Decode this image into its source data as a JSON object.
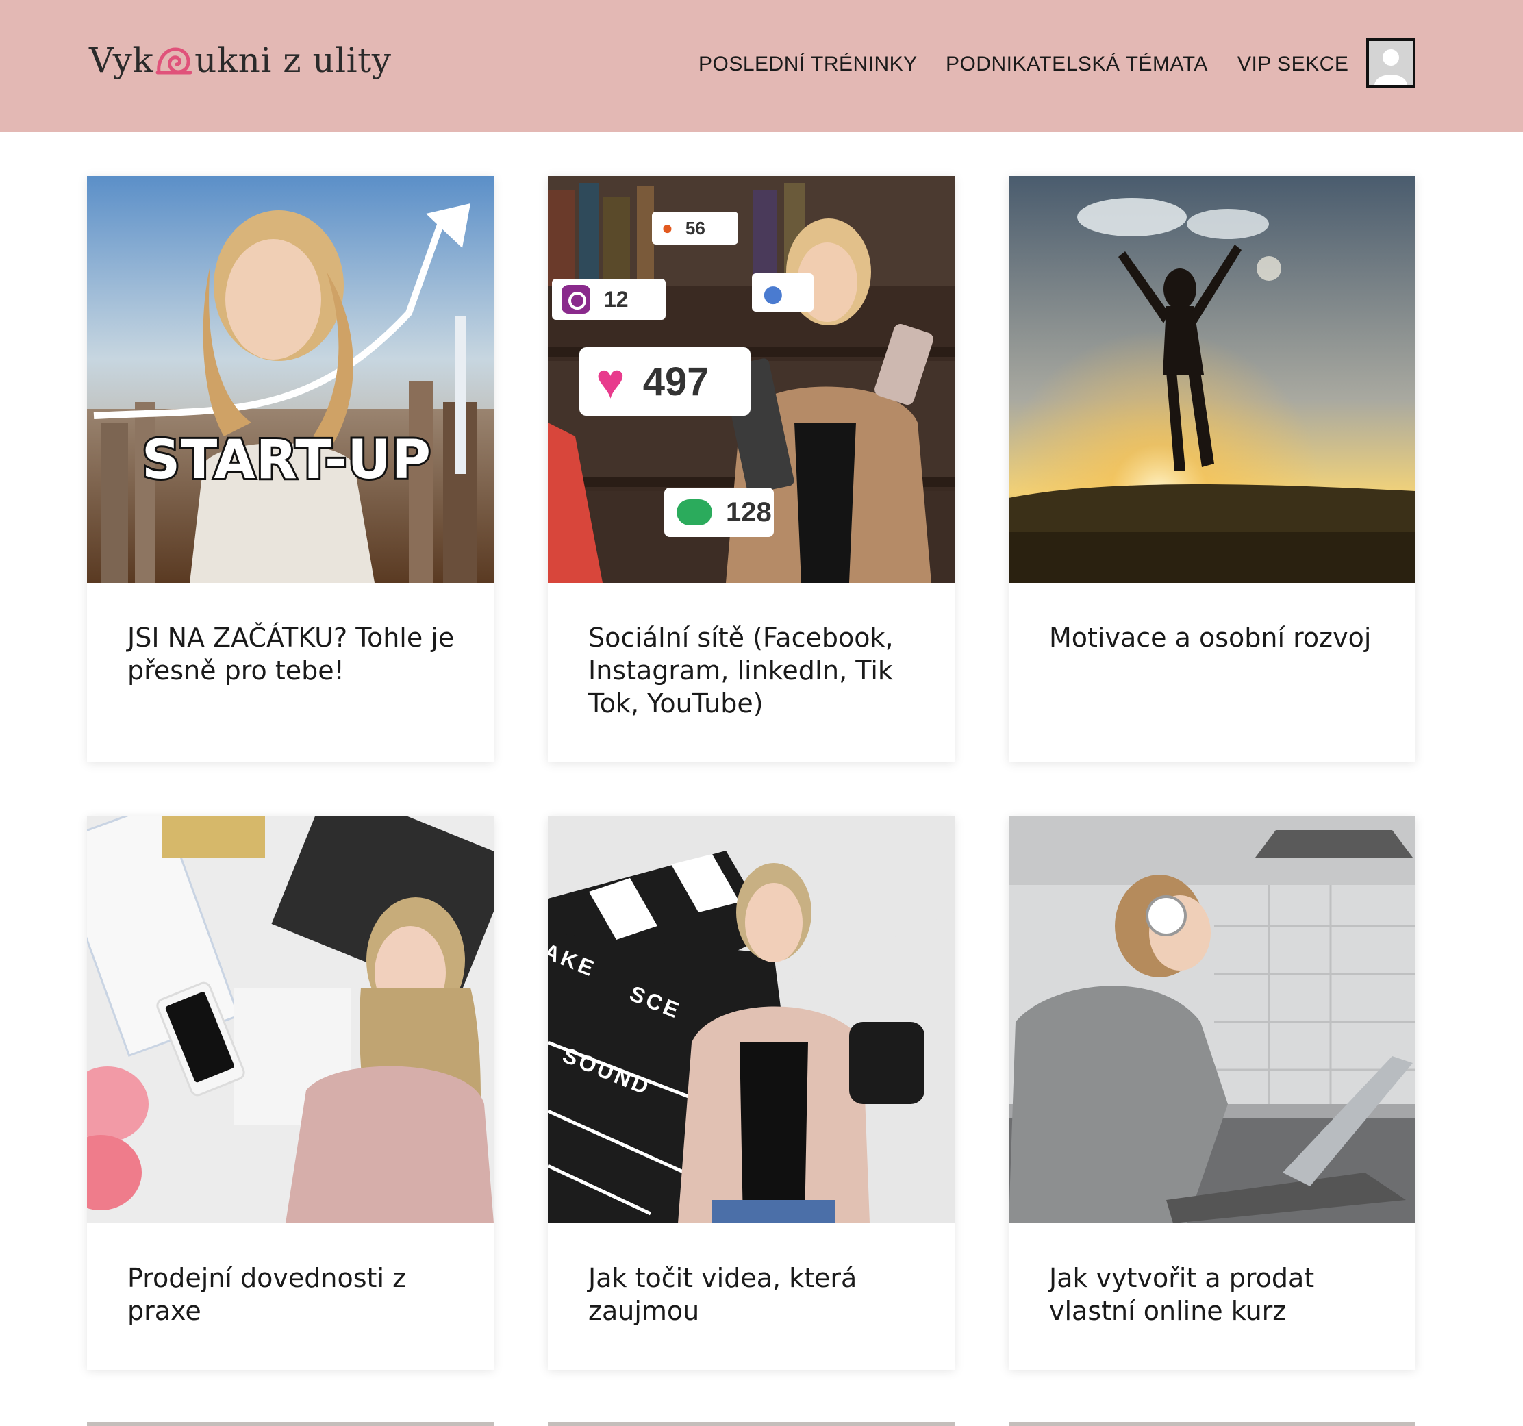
{
  "header": {
    "logo_left": "Vyk",
    "logo_right": "ukni z ulity",
    "nav": [
      {
        "label": "POSLEDNÍ TRÉNINKY"
      },
      {
        "label": "PODNIKATELSKÁ TÉMATA"
      },
      {
        "label": "VIP SEKCE"
      }
    ],
    "bg_color": "#e3b8b4"
  },
  "cards": [
    {
      "title": "JSI NA ZAČÁTKU? Tohle je přesně pro tebe!",
      "image_text": "START-UP"
    },
    {
      "title": "Sociální sítě (Facebook, Instagram, linkedIn, Tik Tok, YouTube)",
      "image_badges": {
        "location": "56",
        "photos": "12",
        "likes": "497",
        "comments": "128"
      }
    },
    {
      "title": "Motivace a osobní rozvoj"
    },
    {
      "title": "Prodejní dovednosti z praxe"
    },
    {
      "title": "Jak točit videa, která zaujmou",
      "image_text": {
        "take": "AKE",
        "scene": "SCE",
        "sound": "SOUND"
      }
    },
    {
      "title": "Jak vytvořit a prodat vlastní online kurz"
    }
  ]
}
